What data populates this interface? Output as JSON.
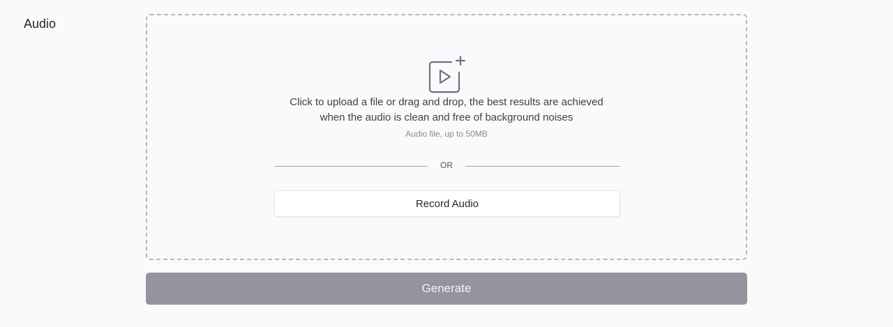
{
  "field": {
    "label": "Audio"
  },
  "dropzone": {
    "icon": "video-add-icon",
    "line1": "Click to upload a file or drag and drop, the best results are achieved",
    "line2": "when the audio is clean and free of background noises",
    "hint": "Audio file, up to 50MB",
    "or": "OR",
    "record_label": "Record Audio"
  },
  "actions": {
    "generate_label": "Generate"
  },
  "colors": {
    "background": "#f9fafb",
    "dropzone_border": "#b4b8c2",
    "generate_button": "#94949e",
    "generate_text": "#f4f4f5"
  }
}
